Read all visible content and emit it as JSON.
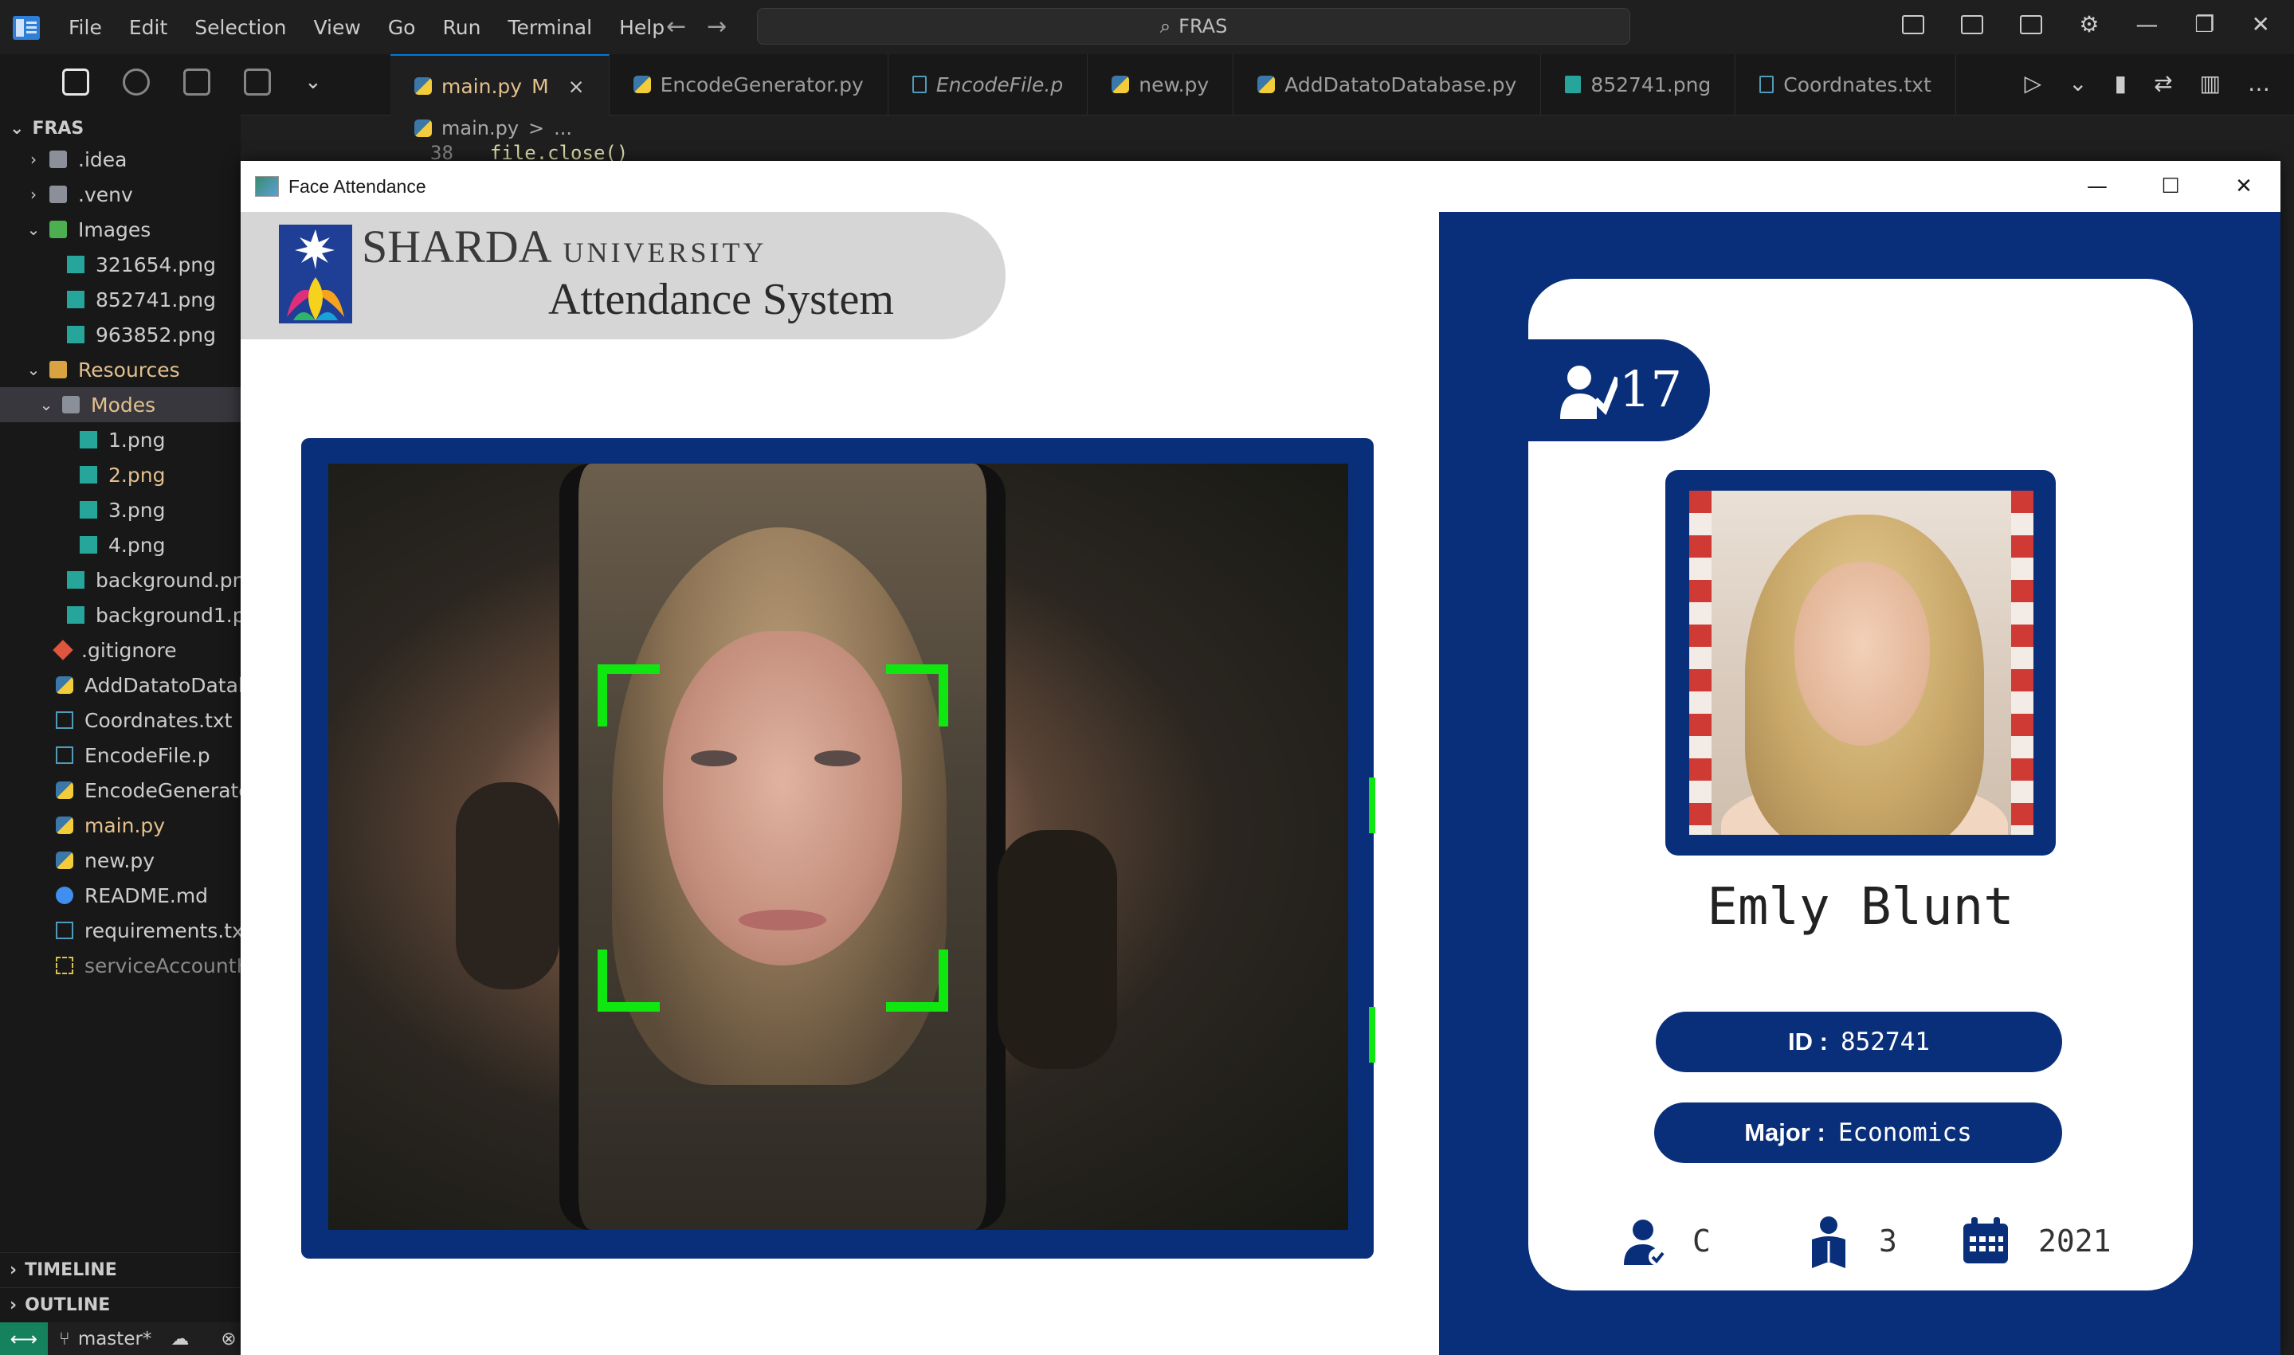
{
  "vscode": {
    "menu": [
      "File",
      "Edit",
      "Selection",
      "View",
      "Go",
      "Run",
      "Terminal",
      "Help"
    ],
    "search_text": "FRAS",
    "tabs": [
      {
        "label": "main.py",
        "badge": "M",
        "close": "×"
      },
      {
        "label": "EncodeGenerator.py"
      },
      {
        "label": "EncodeFile.p"
      },
      {
        "label": "new.py"
      },
      {
        "label": "AddDatatoDatabase.py"
      },
      {
        "label": "852741.png"
      },
      {
        "label": "Coordnates.txt"
      }
    ],
    "breadcrumb": {
      "file": "main.py",
      "sep": ">",
      "rest": "..."
    },
    "code_peek": {
      "line_no": "38",
      "code": "file.close()"
    },
    "explorer": {
      "root": "FRAS",
      "items": [
        {
          "label": ".idea"
        },
        {
          "label": ".venv"
        },
        {
          "label": "Images"
        },
        {
          "label": "321654.png"
        },
        {
          "label": "852741.png"
        },
        {
          "label": "963852.png"
        },
        {
          "label": "Resources"
        },
        {
          "label": "Modes"
        },
        {
          "label": "1.png"
        },
        {
          "label": "2.png"
        },
        {
          "label": "3.png"
        },
        {
          "label": "4.png"
        },
        {
          "label": "background.pn"
        },
        {
          "label": "background1.p"
        },
        {
          "label": ".gitignore"
        },
        {
          "label": "AddDatatoDatab"
        },
        {
          "label": "Coordnates.txt"
        },
        {
          "label": "EncodeFile.p"
        },
        {
          "label": "EncodeGenerato"
        },
        {
          "label": "main.py"
        },
        {
          "label": "new.py"
        },
        {
          "label": "README.md"
        },
        {
          "label": "requirements.txt"
        },
        {
          "label": "serviceAccountK"
        }
      ]
    },
    "timeline": "TIMELINE",
    "outline": "OUTLINE",
    "status": {
      "branch": "master*"
    }
  },
  "face_window": {
    "title": "Face Attendance",
    "university_big": "SHARDA",
    "university_small": "UNIVERSITY",
    "system_title": "Attendance System",
    "attendance_count": "17",
    "student_name": "Emly Blunt",
    "id_label": "ID :",
    "id_value": "852741",
    "major_label": "Major :",
    "major_value": "Economics",
    "standing": "C",
    "year": "3",
    "starting_year": "2021"
  },
  "colors": {
    "navy": "#0a2f7a",
    "green_bracket": "#10e610",
    "vscode_bg": "#1f1f1f"
  }
}
